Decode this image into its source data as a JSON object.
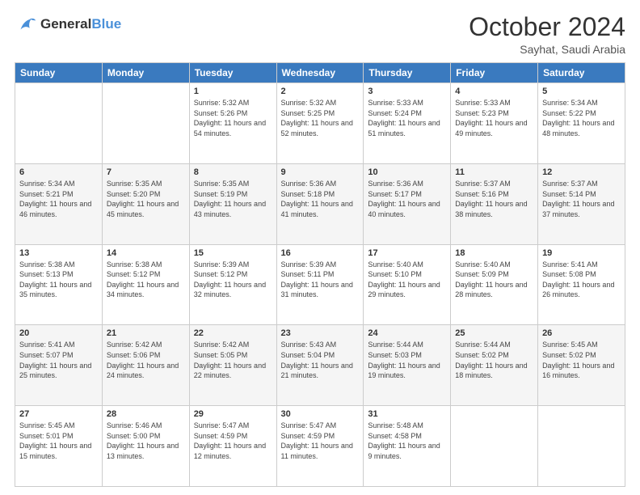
{
  "logo": {
    "line1": "General",
    "line2": "Blue"
  },
  "header": {
    "month_year": "October 2024",
    "location": "Sayhat, Saudi Arabia"
  },
  "weekdays": [
    "Sunday",
    "Monday",
    "Tuesday",
    "Wednesday",
    "Thursday",
    "Friday",
    "Saturday"
  ],
  "weeks": [
    [
      {
        "day": "",
        "sunrise": "",
        "sunset": "",
        "daylight": ""
      },
      {
        "day": "",
        "sunrise": "",
        "sunset": "",
        "daylight": ""
      },
      {
        "day": "1",
        "sunrise": "Sunrise: 5:32 AM",
        "sunset": "Sunset: 5:26 PM",
        "daylight": "Daylight: 11 hours and 54 minutes."
      },
      {
        "day": "2",
        "sunrise": "Sunrise: 5:32 AM",
        "sunset": "Sunset: 5:25 PM",
        "daylight": "Daylight: 11 hours and 52 minutes."
      },
      {
        "day": "3",
        "sunrise": "Sunrise: 5:33 AM",
        "sunset": "Sunset: 5:24 PM",
        "daylight": "Daylight: 11 hours and 51 minutes."
      },
      {
        "day": "4",
        "sunrise": "Sunrise: 5:33 AM",
        "sunset": "Sunset: 5:23 PM",
        "daylight": "Daylight: 11 hours and 49 minutes."
      },
      {
        "day": "5",
        "sunrise": "Sunrise: 5:34 AM",
        "sunset": "Sunset: 5:22 PM",
        "daylight": "Daylight: 11 hours and 48 minutes."
      }
    ],
    [
      {
        "day": "6",
        "sunrise": "Sunrise: 5:34 AM",
        "sunset": "Sunset: 5:21 PM",
        "daylight": "Daylight: 11 hours and 46 minutes."
      },
      {
        "day": "7",
        "sunrise": "Sunrise: 5:35 AM",
        "sunset": "Sunset: 5:20 PM",
        "daylight": "Daylight: 11 hours and 45 minutes."
      },
      {
        "day": "8",
        "sunrise": "Sunrise: 5:35 AM",
        "sunset": "Sunset: 5:19 PM",
        "daylight": "Daylight: 11 hours and 43 minutes."
      },
      {
        "day": "9",
        "sunrise": "Sunrise: 5:36 AM",
        "sunset": "Sunset: 5:18 PM",
        "daylight": "Daylight: 11 hours and 41 minutes."
      },
      {
        "day": "10",
        "sunrise": "Sunrise: 5:36 AM",
        "sunset": "Sunset: 5:17 PM",
        "daylight": "Daylight: 11 hours and 40 minutes."
      },
      {
        "day": "11",
        "sunrise": "Sunrise: 5:37 AM",
        "sunset": "Sunset: 5:16 PM",
        "daylight": "Daylight: 11 hours and 38 minutes."
      },
      {
        "day": "12",
        "sunrise": "Sunrise: 5:37 AM",
        "sunset": "Sunset: 5:14 PM",
        "daylight": "Daylight: 11 hours and 37 minutes."
      }
    ],
    [
      {
        "day": "13",
        "sunrise": "Sunrise: 5:38 AM",
        "sunset": "Sunset: 5:13 PM",
        "daylight": "Daylight: 11 hours and 35 minutes."
      },
      {
        "day": "14",
        "sunrise": "Sunrise: 5:38 AM",
        "sunset": "Sunset: 5:12 PM",
        "daylight": "Daylight: 11 hours and 34 minutes."
      },
      {
        "day": "15",
        "sunrise": "Sunrise: 5:39 AM",
        "sunset": "Sunset: 5:12 PM",
        "daylight": "Daylight: 11 hours and 32 minutes."
      },
      {
        "day": "16",
        "sunrise": "Sunrise: 5:39 AM",
        "sunset": "Sunset: 5:11 PM",
        "daylight": "Daylight: 11 hours and 31 minutes."
      },
      {
        "day": "17",
        "sunrise": "Sunrise: 5:40 AM",
        "sunset": "Sunset: 5:10 PM",
        "daylight": "Daylight: 11 hours and 29 minutes."
      },
      {
        "day": "18",
        "sunrise": "Sunrise: 5:40 AM",
        "sunset": "Sunset: 5:09 PM",
        "daylight": "Daylight: 11 hours and 28 minutes."
      },
      {
        "day": "19",
        "sunrise": "Sunrise: 5:41 AM",
        "sunset": "Sunset: 5:08 PM",
        "daylight": "Daylight: 11 hours and 26 minutes."
      }
    ],
    [
      {
        "day": "20",
        "sunrise": "Sunrise: 5:41 AM",
        "sunset": "Sunset: 5:07 PM",
        "daylight": "Daylight: 11 hours and 25 minutes."
      },
      {
        "day": "21",
        "sunrise": "Sunrise: 5:42 AM",
        "sunset": "Sunset: 5:06 PM",
        "daylight": "Daylight: 11 hours and 24 minutes."
      },
      {
        "day": "22",
        "sunrise": "Sunrise: 5:42 AM",
        "sunset": "Sunset: 5:05 PM",
        "daylight": "Daylight: 11 hours and 22 minutes."
      },
      {
        "day": "23",
        "sunrise": "Sunrise: 5:43 AM",
        "sunset": "Sunset: 5:04 PM",
        "daylight": "Daylight: 11 hours and 21 minutes."
      },
      {
        "day": "24",
        "sunrise": "Sunrise: 5:44 AM",
        "sunset": "Sunset: 5:03 PM",
        "daylight": "Daylight: 11 hours and 19 minutes."
      },
      {
        "day": "25",
        "sunrise": "Sunrise: 5:44 AM",
        "sunset": "Sunset: 5:02 PM",
        "daylight": "Daylight: 11 hours and 18 minutes."
      },
      {
        "day": "26",
        "sunrise": "Sunrise: 5:45 AM",
        "sunset": "Sunset: 5:02 PM",
        "daylight": "Daylight: 11 hours and 16 minutes."
      }
    ],
    [
      {
        "day": "27",
        "sunrise": "Sunrise: 5:45 AM",
        "sunset": "Sunset: 5:01 PM",
        "daylight": "Daylight: 11 hours and 15 minutes."
      },
      {
        "day": "28",
        "sunrise": "Sunrise: 5:46 AM",
        "sunset": "Sunset: 5:00 PM",
        "daylight": "Daylight: 11 hours and 13 minutes."
      },
      {
        "day": "29",
        "sunrise": "Sunrise: 5:47 AM",
        "sunset": "Sunset: 4:59 PM",
        "daylight": "Daylight: 11 hours and 12 minutes."
      },
      {
        "day": "30",
        "sunrise": "Sunrise: 5:47 AM",
        "sunset": "Sunset: 4:59 PM",
        "daylight": "Daylight: 11 hours and 11 minutes."
      },
      {
        "day": "31",
        "sunrise": "Sunrise: 5:48 AM",
        "sunset": "Sunset: 4:58 PM",
        "daylight": "Daylight: 11 hours and 9 minutes."
      },
      {
        "day": "",
        "sunrise": "",
        "sunset": "",
        "daylight": ""
      },
      {
        "day": "",
        "sunrise": "",
        "sunset": "",
        "daylight": ""
      }
    ]
  ]
}
